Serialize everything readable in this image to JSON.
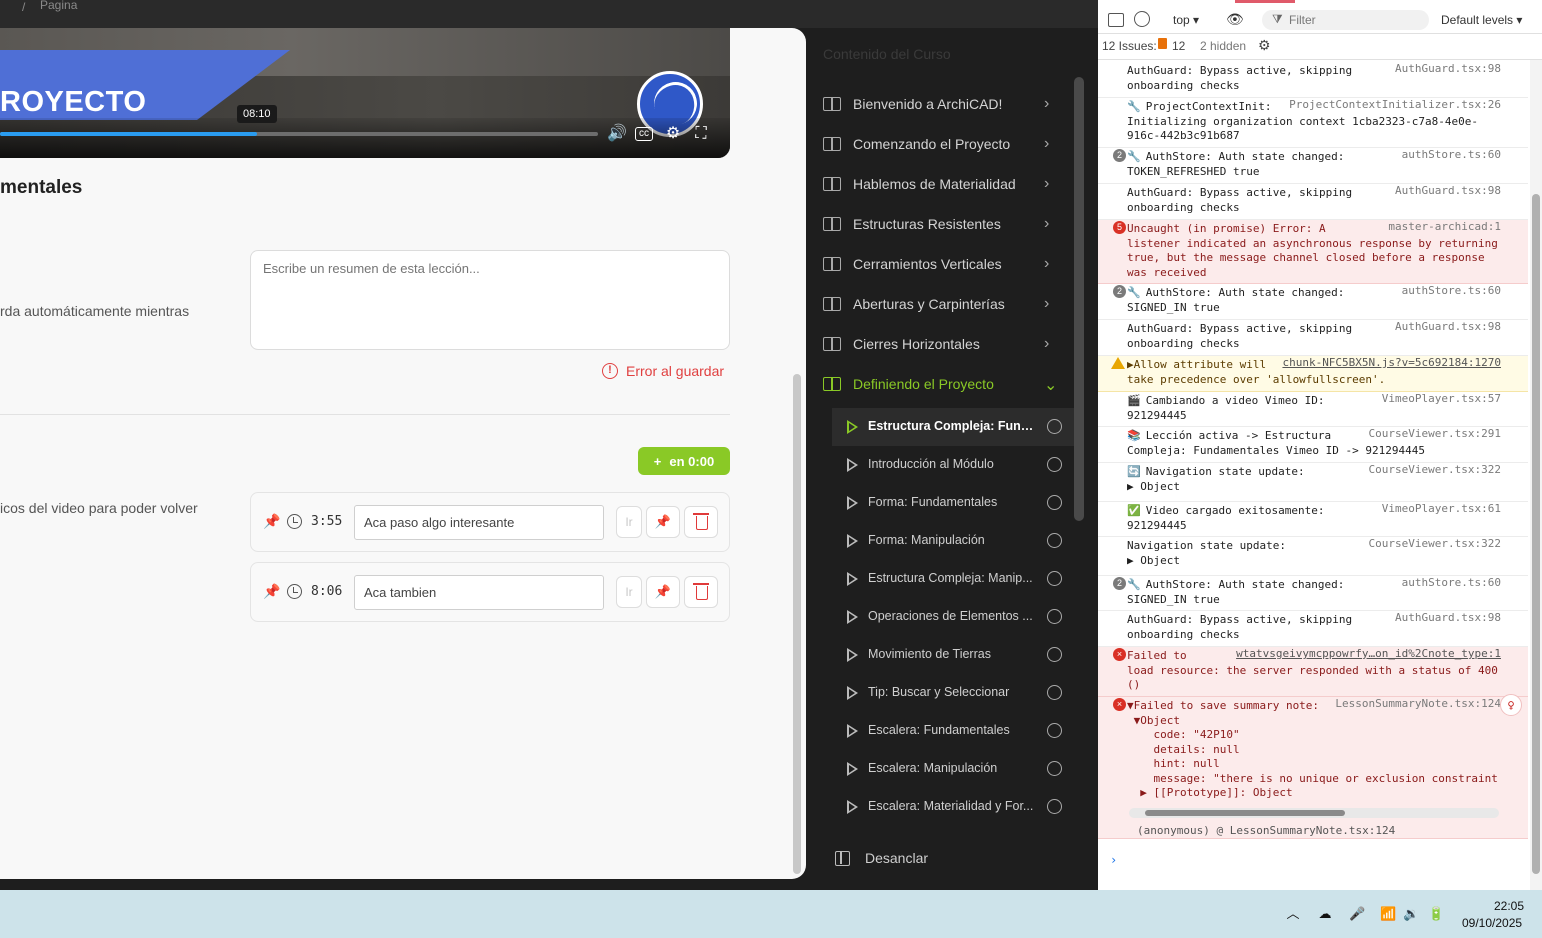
{
  "breadcrumb": {
    "separator": "/",
    "current": "Pagina"
  },
  "video": {
    "banner_text": "ROYECTO",
    "time_tooltip": "08:10",
    "progress": 0.43,
    "accent_color": "#2a9cf0",
    "icons": [
      "volume-icon",
      "captions-icon",
      "settings-icon",
      "fullscreen-icon"
    ]
  },
  "lesson": {
    "title": "mentales",
    "autosave_text": "rda automáticamente mientras",
    "summary_placeholder": "Escribe un resumen de esta lección...",
    "save_error": "Error al guardar",
    "add_note_label": "en 0:00",
    "bookmarks_text": "icos del video para poder volver",
    "notes": [
      {
        "time": "3:55",
        "text": "Aca paso algo interesante",
        "go_label": "Ir"
      },
      {
        "time": "8:06",
        "text": "Aca tambien",
        "go_label": "Ir"
      }
    ]
  },
  "course": {
    "title": "Contenido del Curso",
    "chapters": [
      {
        "label": "Bienvenido a ArchiCAD!",
        "expanded": false
      },
      {
        "label": "Comenzando el Proyecto",
        "expanded": false
      },
      {
        "label": "Hablemos de Materialidad",
        "expanded": false
      },
      {
        "label": "Estructuras Resistentes",
        "expanded": false
      },
      {
        "label": "Cerramientos Verticales",
        "expanded": false
      },
      {
        "label": "Aberturas y Carpinterías",
        "expanded": false
      },
      {
        "label": "Cierres Horizontales",
        "expanded": false
      },
      {
        "label": "Definiendo el Proyecto",
        "expanded": true
      }
    ],
    "lessons": [
      {
        "label": "Estructura Compleja: Funda...",
        "current": true
      },
      {
        "label": "Introducción al Módulo",
        "current": false
      },
      {
        "label": "Forma: Fundamentales",
        "current": false
      },
      {
        "label": "Forma: Manipulación",
        "current": false
      },
      {
        "label": "Estructura Compleja: Manip...",
        "current": false
      },
      {
        "label": "Operaciones de Elementos ...",
        "current": false
      },
      {
        "label": "Movimiento de Tierras",
        "current": false
      },
      {
        "label": "Tip: Buscar y Seleccionar",
        "current": false
      },
      {
        "label": "Escalera: Fundamentales",
        "current": false
      },
      {
        "label": "Escalera: Manipulación",
        "current": false
      },
      {
        "label": "Escalera: Materialidad y For...",
        "current": false
      }
    ],
    "undock_label": "Desanclar",
    "accent_color": "#8ac926"
  },
  "devtools": {
    "context": "top",
    "filter_placeholder": "Filter",
    "levels": "Default levels",
    "issues_label": "12 Issues:",
    "issues_count": "12",
    "hidden_label": "2 hidden",
    "messages": [
      {
        "type": "log",
        "text": "AuthGuard: Bypass active, skipping\nonboarding checks",
        "source": "AuthGuard.tsx:98"
      },
      {
        "type": "log",
        "icon": "🔧",
        "text": "ProjectContextInit:\nInitializing organization context 1cba2323-c7a8-4e0e-\n916c-442b3c91b687",
        "source": "ProjectContextInitializer.tsx:26"
      },
      {
        "type": "log",
        "count": "2",
        "icon": "🔧",
        "text": "AuthStore: Auth state changed:\nTOKEN_REFRESHED true",
        "source": "authStore.ts:60"
      },
      {
        "type": "log",
        "text": "AuthGuard: Bypass active, skipping\nonboarding checks",
        "source": "AuthGuard.tsx:98"
      },
      {
        "type": "error",
        "count": "5",
        "text": "Uncaught (in promise) Error: A\nlistener indicated an asynchronous response by returning\ntrue, but the message channel closed before a response\nwas received",
        "source": "master-archicad:1"
      },
      {
        "type": "log",
        "count": "2",
        "icon": "🔧",
        "text": "AuthStore: Auth state changed:\nSIGNED_IN true",
        "source": "authStore.ts:60"
      },
      {
        "type": "log",
        "text": "AuthGuard: Bypass active, skipping\nonboarding checks",
        "source": "AuthGuard.tsx:98"
      },
      {
        "type": "warn",
        "text": "▶Allow attribute will\ntake precedence over 'allowfullscreen'.",
        "source": "chunk-NFC5BX5N.js?v=5c692184:1270"
      },
      {
        "type": "log",
        "icon": "🎬",
        "text": "Cambiando a video Vimeo ID:\n921294445",
        "source": "VimeoPlayer.tsx:57"
      },
      {
        "type": "log",
        "icon": "📚",
        "text": "Lección activa -> Estructura\nCompleja: Fundamentales Vimeo ID -> 921294445",
        "source": "CourseViewer.tsx:291"
      },
      {
        "type": "log",
        "icon": "🔄",
        "text": "Navigation state update:\n▶ Object",
        "source": "CourseViewer.tsx:322"
      },
      {
        "type": "log",
        "icon": "✅",
        "text": "Video cargado exitosamente:\n921294445",
        "source": "VimeoPlayer.tsx:61"
      },
      {
        "type": "log",
        "text": "Navigation state update:\n▶ Object",
        "source": "CourseViewer.tsx:322"
      },
      {
        "type": "log",
        "count": "2",
        "icon": "🔧",
        "text": "AuthStore: Auth state changed:\nSIGNED_IN true",
        "source": "authStore.ts:60"
      },
      {
        "type": "log",
        "text": "AuthGuard: Bypass active, skipping\nonboarding checks",
        "source": "AuthGuard.tsx:98"
      },
      {
        "type": "error",
        "text": "Failed to\nload resource: the server responded with a status of 400\n()",
        "source": "wtatvsgeivymcppowrfy…on_id%2Cnote_type:1"
      },
      {
        "type": "error",
        "text": "▼Failed to save summary note:\n ▼Object\n    code: \"42P10\"\n    details: null\n    hint: null\n    message: \"there is no unique or exclusion constraint\n  ▶ [[Prototype]]: Object",
        "source": "LessonSummaryNote.tsx:124"
      }
    ],
    "trace": "(anonymous) @ LessonSummaryNote.tsx:124",
    "trace_src": "LessonSummaryNote.tsx:124",
    "prompt": "›"
  },
  "taskbar": {
    "time": "22:05",
    "date": "09/10/2025",
    "tray_icons": [
      "chevron-up-icon",
      "cloud-icon",
      "mic-icon",
      "wifi-icon",
      "speaker-icon",
      "battery-icon"
    ]
  }
}
